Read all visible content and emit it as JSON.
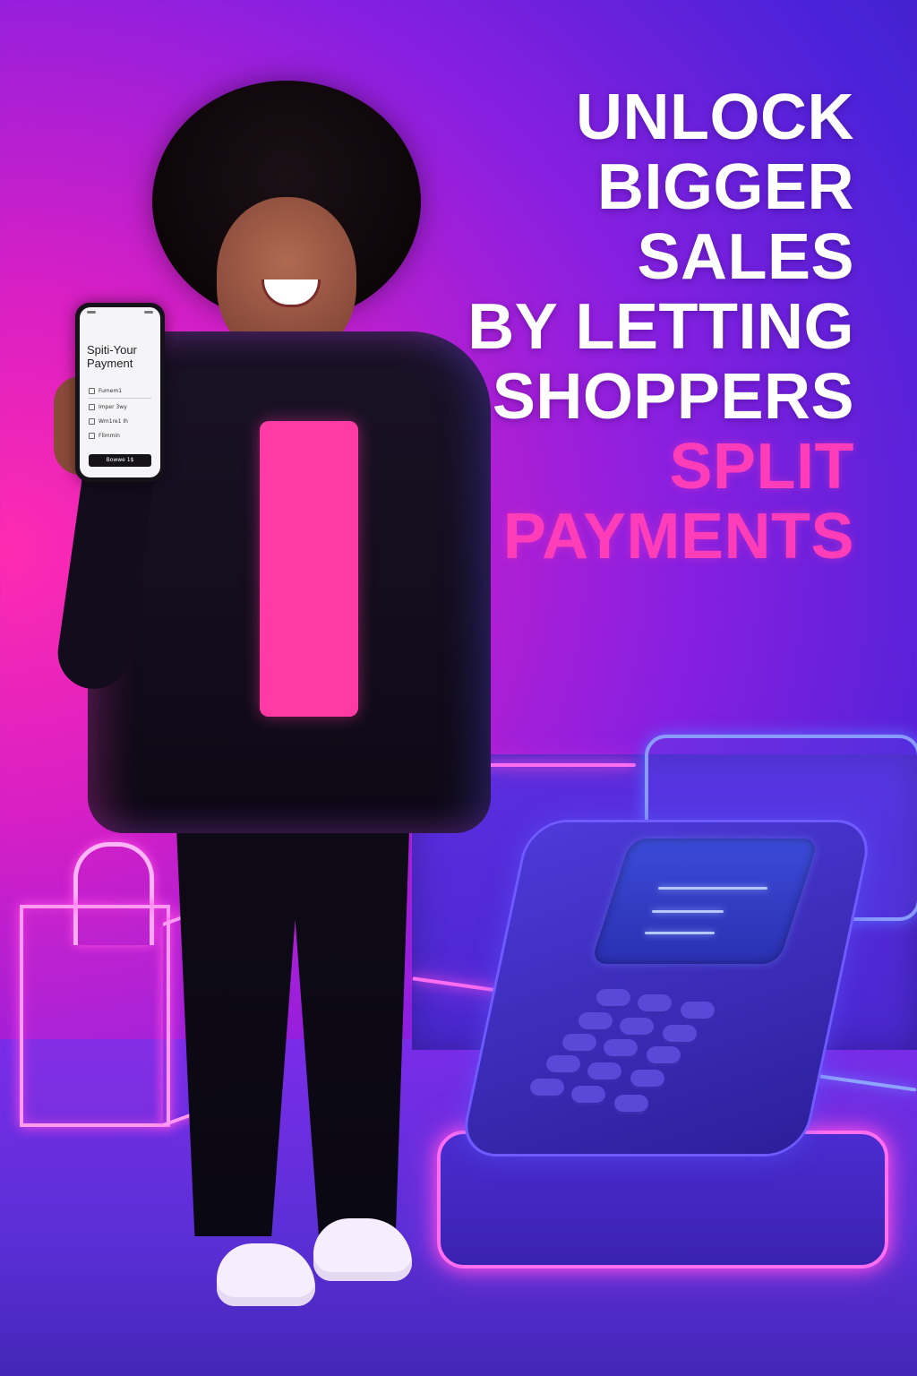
{
  "headline": {
    "line1": "UNLOCK",
    "line2": "BIGGER",
    "line3": "SALES",
    "line4": "BY LETTING",
    "line5": "SHOPPERS",
    "line6": "SPLIT",
    "line7": "PAYMENTS"
  },
  "phone": {
    "title": "Spiti-Your Payment",
    "options": [
      "Fumem1",
      "Imper 3wy",
      "Wm1re1 Ih",
      "Flimmin"
    ],
    "button": "Bowwe 1$"
  },
  "colors": {
    "accent_pink": "#ff3db8",
    "headline_white": "#ffffff",
    "neon_pink": "#ff4de8",
    "neon_blue": "#6f7bff"
  },
  "icons": [
    "shopping-bag-icon",
    "pos-terminal-icon"
  ]
}
